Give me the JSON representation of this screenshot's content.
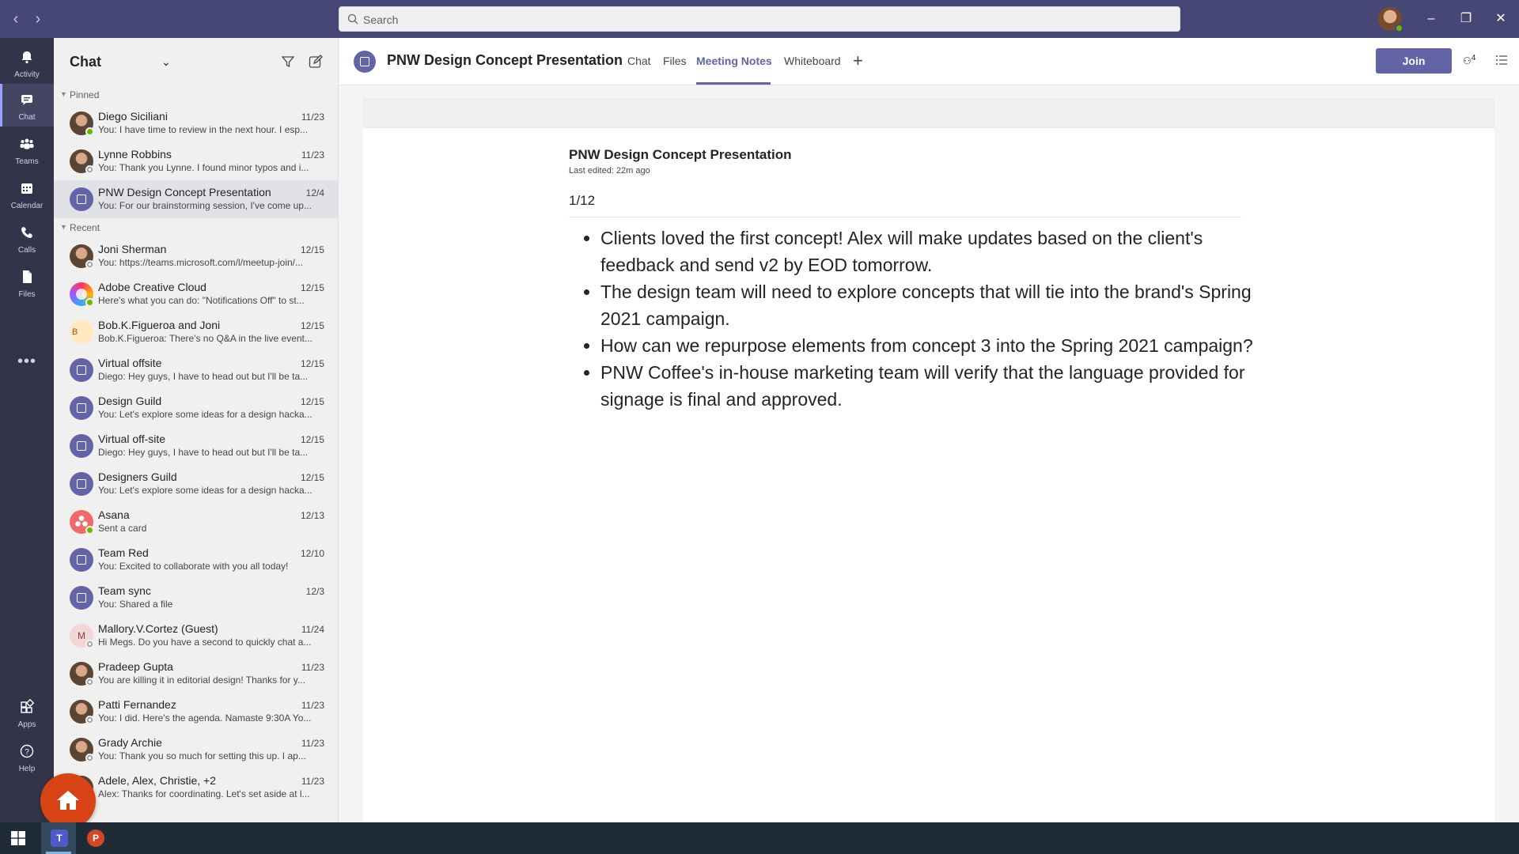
{
  "titlebar": {
    "search_placeholder": "Search",
    "back_icon": "chevron-left-icon",
    "forward_icon": "chevron-right-icon",
    "window_controls": [
      "minimize",
      "restore",
      "close"
    ]
  },
  "rail": {
    "items": [
      {
        "label": "Activity",
        "icon": "bell-icon"
      },
      {
        "label": "Chat",
        "icon": "chat-icon",
        "active": true
      },
      {
        "label": "Teams",
        "icon": "teams-icon"
      },
      {
        "label": "Calendar",
        "icon": "calendar-icon"
      },
      {
        "label": "Calls",
        "icon": "phone-icon"
      },
      {
        "label": "Files",
        "icon": "files-icon"
      }
    ],
    "bottom": [
      {
        "label": "Apps",
        "icon": "apps-icon"
      },
      {
        "label": "Help",
        "icon": "help-icon"
      }
    ]
  },
  "chatlist": {
    "title": "Chat",
    "pinned_label": "Pinned",
    "recent_label": "Recent",
    "pinned": [
      {
        "name": "Diego Siciliani",
        "date": "11/23",
        "preview": "You: I have time to review in the next hour. I esp..."
      },
      {
        "name": "Lynne Robbins",
        "date": "11/23",
        "preview": "You: Thank you Lynne. I found minor typos and i..."
      },
      {
        "name": "PNW Design Concept Presentation",
        "date": "12/4",
        "preview": "You: For our brainstorming session, I've come up..."
      }
    ],
    "recent": [
      {
        "name": "Joni Sherman",
        "date": "12/15",
        "preview": "You: https://teams.microsoft.com/l/meetup-join/..."
      },
      {
        "name": "Adobe Creative Cloud",
        "date": "12/15",
        "preview": "Here's what you can do: \"Notifications Off\" to st..."
      },
      {
        "name": "Bob.K.Figueroa and Joni",
        "date": "12/15",
        "preview": "Bob.K.Figueroa: There's no Q&A in the live event..."
      },
      {
        "name": "Virtual offsite",
        "date": "12/15",
        "preview": "Diego: Hey guys, I have to head out but I'll be ta..."
      },
      {
        "name": "Design Guild",
        "date": "12/15",
        "preview": "You: Let's explore some ideas for a design hacka..."
      },
      {
        "name": "Virtual off-site",
        "date": "12/15",
        "preview": "Diego: Hey guys, I have to head out but I'll be ta..."
      },
      {
        "name": "Designers Guild",
        "date": "12/15",
        "preview": "You: Let's explore some ideas for a design hacka..."
      },
      {
        "name": "Asana",
        "date": "12/13",
        "preview": "Sent a card"
      },
      {
        "name": "Team Red",
        "date": "12/10",
        "preview": "You: Excited to collaborate with you all today!"
      },
      {
        "name": "Team sync",
        "date": "12/3",
        "preview": "You: Shared a file"
      },
      {
        "name": "Mallory.V.Cortez (Guest)",
        "date": "11/24",
        "preview": "Hi Megs. Do you have a second to quickly chat a..."
      },
      {
        "name": "Pradeep Gupta",
        "date": "11/23",
        "preview": "You are killing it in editorial design! Thanks for y..."
      },
      {
        "name": "Patti Fernandez",
        "date": "11/23",
        "preview": "You: I did. Here's the agenda. Namaste 9:30A Yo..."
      },
      {
        "name": "Grady Archie",
        "date": "11/23",
        "preview": "You: Thank you so much for setting this up. I ap..."
      },
      {
        "name": "Adele, Alex, Christie, +2",
        "date": "11/23",
        "preview": "Alex: Thanks for coordinating. Let's set aside at l..."
      }
    ]
  },
  "main": {
    "title": "PNW Design Concept Presentation",
    "tabs": [
      "Chat",
      "Files",
      "Meeting Notes",
      "Whiteboard"
    ],
    "active_tab": "Meeting Notes",
    "join_label": "Join",
    "participant_count": "4",
    "notes": {
      "title": "PNW Design Concept Presentation",
      "edited": "Last edited: 22m ago",
      "date": "1/12",
      "bullets": [
        "Clients loved the first concept! Alex will make updates based on the client's feedback and send v2 by EOD tomorrow.",
        "The design team will need to explore concepts that will tie into the brand's Spring 2021 campaign.",
        "How can we repurpose elements from concept 3 into the Spring 2021 campaign?",
        "PNW Coffee's in-house marketing team will verify that the language provided for signage is final and approved."
      ]
    }
  },
  "taskbar": {
    "apps": [
      "windows-start-icon",
      "teams-icon",
      "powerpoint-icon"
    ],
    "teams_letter": "T",
    "ppt_letter": "P"
  },
  "colors": {
    "titlebar": "#464775",
    "rail": "#33344a",
    "accent": "#6264a7",
    "home_fab": "#d84315"
  }
}
